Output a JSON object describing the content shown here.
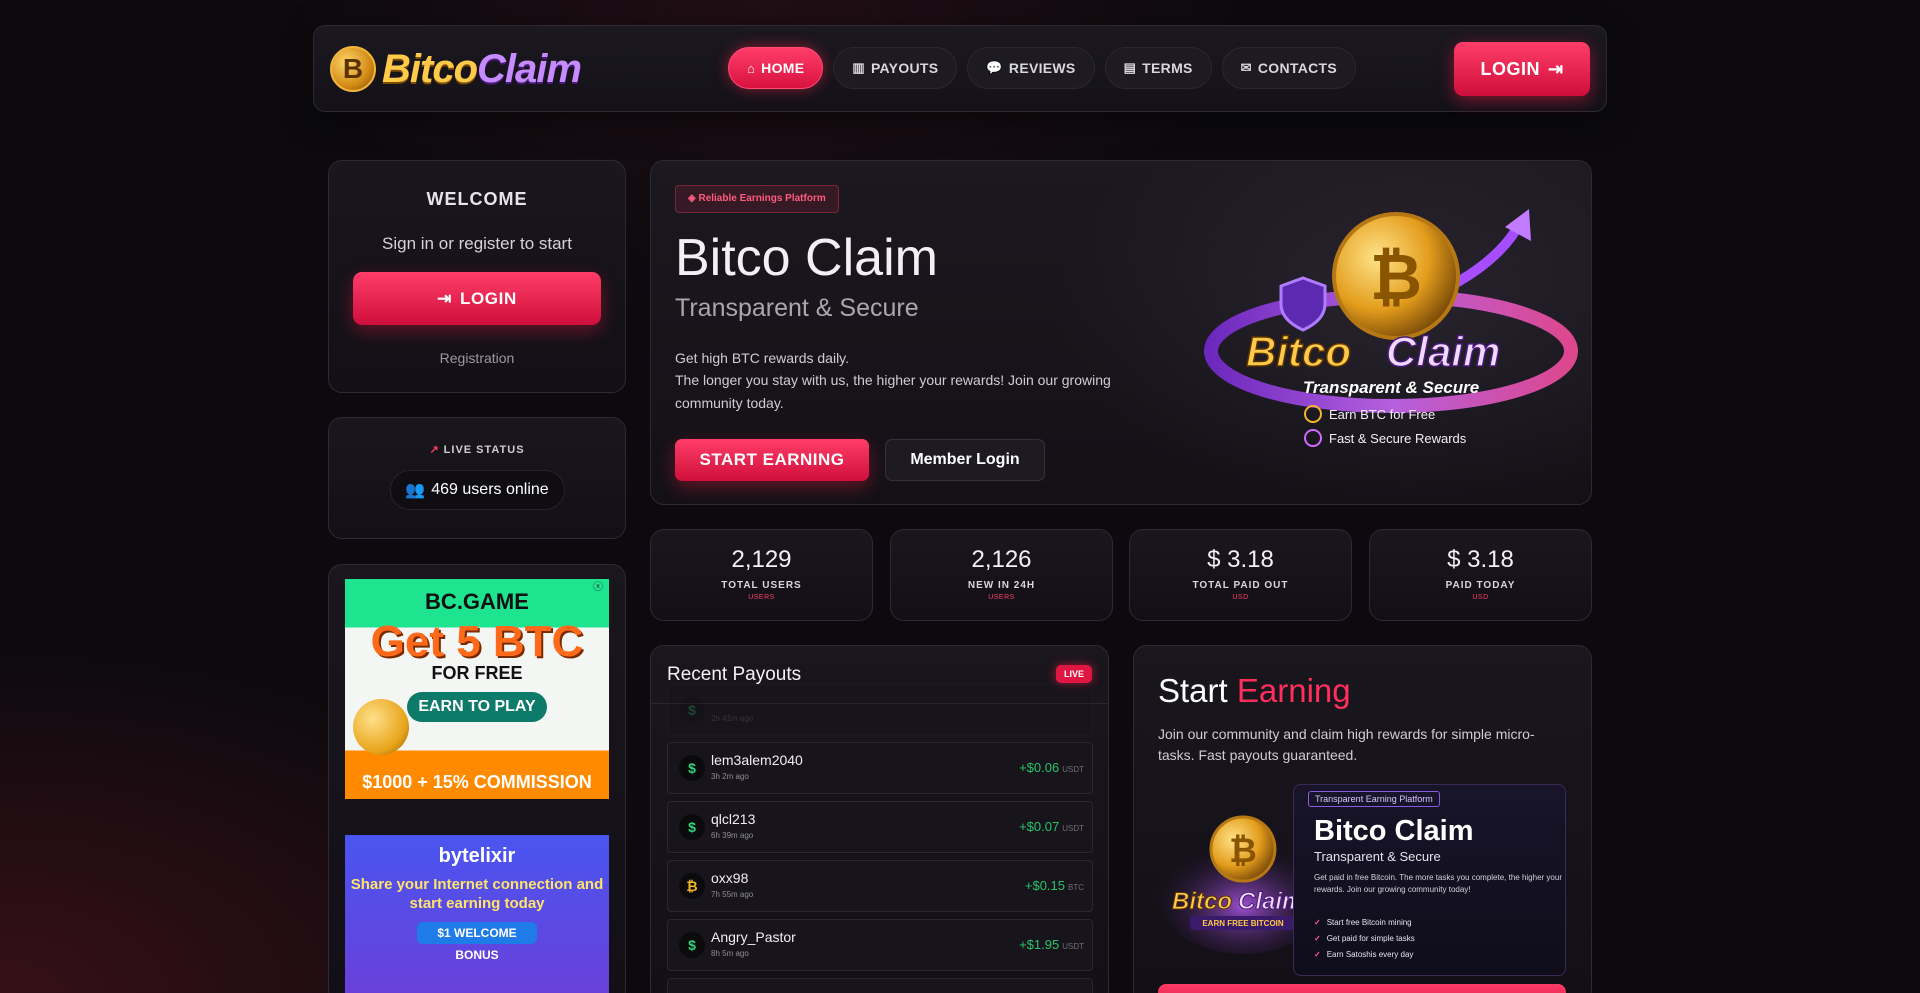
{
  "header": {
    "logo_left": "Bitco",
    "logo_right": "Claim",
    "logo_coin": "B",
    "nav": [
      {
        "label": "HOME",
        "icon": "home-icon",
        "glyph": "⌂"
      },
      {
        "label": "PAYOUTS",
        "icon": "bar-chart-icon",
        "glyph": "▥"
      },
      {
        "label": "REVIEWS",
        "icon": "comments-icon",
        "glyph": "💬"
      },
      {
        "label": "TERMS",
        "icon": "file-icon",
        "glyph": "▤"
      },
      {
        "label": "CONTACTS",
        "icon": "envelope-icon",
        "glyph": "✉"
      }
    ],
    "login_label": "LOGIN",
    "login_icon": "sign-in-icon"
  },
  "sidebar": {
    "welcome_title": "WELCOME",
    "welcome_sub": "Sign in or register to start",
    "login_label": "LOGIN",
    "registration": "Registration",
    "live_status_label": "LIVE STATUS",
    "users_online": "469 users online",
    "ads": {
      "ad1": {
        "brand": "BC.GAME",
        "headline": "Get 5 BTC",
        "sub": "FOR FREE",
        "cta": "EARN TO PLAY",
        "footer": "$1000 + 15% COMMISSION"
      },
      "ad2": {
        "brand": "bytelixir",
        "headline": "Share your Internet connection and start earning today",
        "bonus": "$1 WELCOME BONUS"
      }
    }
  },
  "hero": {
    "badge": "Reliable Earnings Platform",
    "title": "Bitco Claim",
    "subtitle": "Transparent & Secure",
    "desc_line1": "Get high BTC rewards daily.",
    "desc_line2": "The longer you stay with us, the higher your rewards! Join our growing community today.",
    "start_button": "START EARNING",
    "member_button": "Member Login",
    "art": {
      "title_left": "Bitco",
      "title_right": "Claim",
      "tagline": "Transparent & Secure",
      "bullet1": "Earn BTC for Free",
      "bullet2": "Fast & Secure Rewards"
    }
  },
  "stats": [
    {
      "value": "2,129",
      "label": "TOTAL USERS",
      "unit": "USERS"
    },
    {
      "value": "2,126",
      "label": "NEW IN 24H",
      "unit": "USERS"
    },
    {
      "value": "$ 3.18",
      "label": "TOTAL PAID OUT",
      "unit": "USD"
    },
    {
      "value": "$ 3.18",
      "label": "PAID TODAY",
      "unit": "USD"
    }
  ],
  "payouts": {
    "title": "Recent Payouts",
    "live_badge": "LIVE",
    "rows": [
      {
        "name": "",
        "ago": "2h 41m ago",
        "amount": "",
        "currency": "",
        "icon": "dollar-icon"
      },
      {
        "name": "lem3alem2040",
        "ago": "3h 2m ago",
        "amount": "+$0.06",
        "currency": "USDT",
        "icon": "dollar-icon"
      },
      {
        "name": "qlcl213",
        "ago": "6h 39m ago",
        "amount": "+$0.07",
        "currency": "USDT",
        "icon": "dollar-icon"
      },
      {
        "name": "oxx98",
        "ago": "7h 55m ago",
        "amount": "+$0.15",
        "currency": "BTC",
        "icon": "bitcoin-icon"
      },
      {
        "name": "Angry_Pastor",
        "ago": "8h 5m ago",
        "amount": "+$1.95",
        "currency": "USDT",
        "icon": "dollar-icon"
      }
    ]
  },
  "earning": {
    "title_white": "Start",
    "title_red": "Earning",
    "desc": "Join our community and claim high rewards for simple micro-tasks. Fast payouts guaranteed.",
    "promo": {
      "tag": "Transparent Earning Platform",
      "title": "Bitco Claim",
      "subtitle": "Transparent & Secure",
      "desc": "Get paid in free Bitcoin. The more tasks you complete, the higher your rewards. Join our growing community today!",
      "items": [
        "Start free Bitcoin mining",
        "Get paid for simple tasks",
        "Earn Satoshis every day"
      ],
      "logo_left": "Bitco",
      "logo_right": "Claim",
      "logo_sub": "EARN FREE BITCOIN"
    }
  },
  "colors": {
    "accent": "#ff2e5b",
    "gold": "#ffc94a",
    "purple": "#c58bff",
    "positive": "#27c46a"
  }
}
